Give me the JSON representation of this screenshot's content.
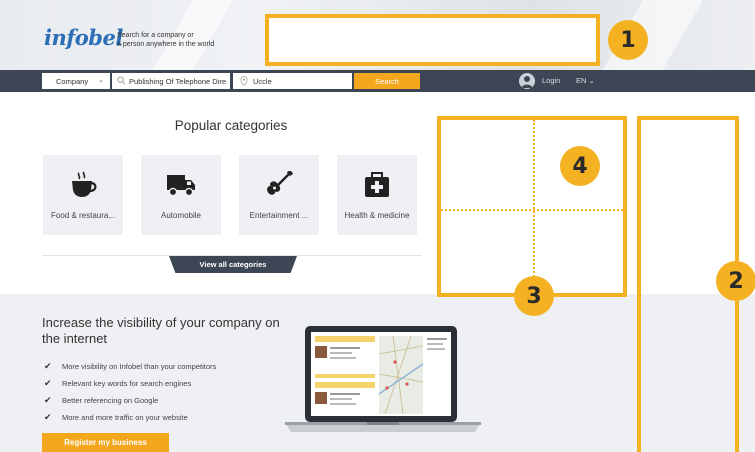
{
  "header": {
    "logo_text": "infobel",
    "tagline_line1": "Search for a company or",
    "tagline_line2": "a person anywhere in the world"
  },
  "annotations": {
    "badge_1": "1",
    "badge_2": "2",
    "badge_3": "3",
    "badge_4": "4"
  },
  "search_bar": {
    "type_selected": "Company",
    "query_value": "Publishing Of Telephone Dire",
    "location_value": "Uccle",
    "search_label": "Search",
    "login_label": "Login",
    "language": "EN"
  },
  "popular": {
    "title": "Popular categories",
    "categories": [
      {
        "label": "Food & restaura...",
        "icon": "coffee-cup-icon"
      },
      {
        "label": "Automobile",
        "icon": "truck-icon"
      },
      {
        "label": "Entertainment ...",
        "icon": "guitar-icon"
      },
      {
        "label": "Health & medicine",
        "icon": "medical-kit-icon"
      }
    ],
    "view_all_label": "View all categories"
  },
  "promo": {
    "title": "Increase the visibility of your company on the internet",
    "bullets": [
      "More visibility on Infobel than your competitors",
      "Relevant key words for search engines",
      "Better referencing on Google",
      "More and more traffic on your website"
    ],
    "register_label": "Register my business"
  },
  "colors": {
    "accent": "#f4b223",
    "button_orange": "#f4a61d",
    "nav_dark": "#3d4654",
    "logo_blue": "#2b6fb6",
    "panel_gray": "#eef0f3"
  }
}
